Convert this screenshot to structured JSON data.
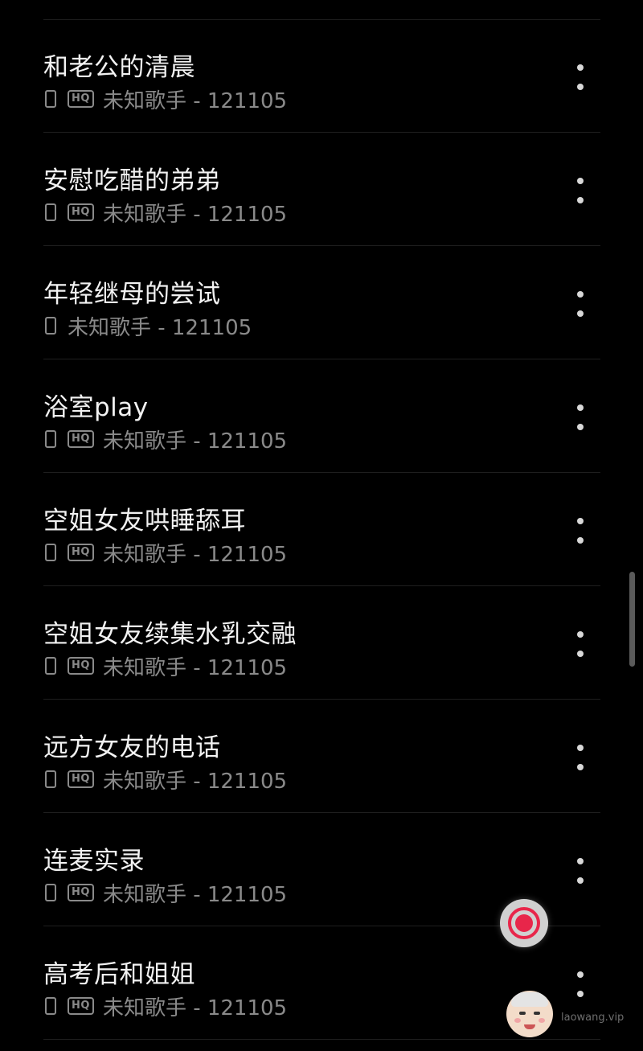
{
  "songs": [
    {
      "title": "和老公的清晨",
      "hq": true,
      "subtitle": "未知歌手 - 121105"
    },
    {
      "title": "安慰吃醋的弟弟",
      "hq": true,
      "subtitle": "未知歌手 - 121105"
    },
    {
      "title": "年轻继母的尝试",
      "hq": false,
      "subtitle": "未知歌手 - 121105"
    },
    {
      "title": "浴室play",
      "hq": true,
      "subtitle": "未知歌手 - 121105"
    },
    {
      "title": "空姐女友哄睡舔耳",
      "hq": true,
      "subtitle": "未知歌手 - 121105"
    },
    {
      "title": "空姐女友续集水乳交融",
      "hq": true,
      "subtitle": "未知歌手 - 121105"
    },
    {
      "title": "远方女友的电话",
      "hq": true,
      "subtitle": "未知歌手 - 121105"
    },
    {
      "title": "连麦实录",
      "hq": true,
      "subtitle": "未知歌手 - 121105"
    },
    {
      "title": "高考后和姐姐",
      "hq": true,
      "subtitle": "未知歌手 - 121105"
    }
  ],
  "badges": {
    "hq": "HQ"
  },
  "icons": {
    "local": "phone-icon",
    "quality": "hq-icon",
    "more": "more-vertical-icon",
    "record": "record-icon",
    "watermark": "old-man-face-icon"
  },
  "watermark": {
    "text": "laowang.vip"
  },
  "colors": {
    "background": "#000000",
    "title": "#f2f2f2",
    "subtitle": "#8a8a8a",
    "divider": "#1f1f1f",
    "accent": "#e8264a"
  }
}
